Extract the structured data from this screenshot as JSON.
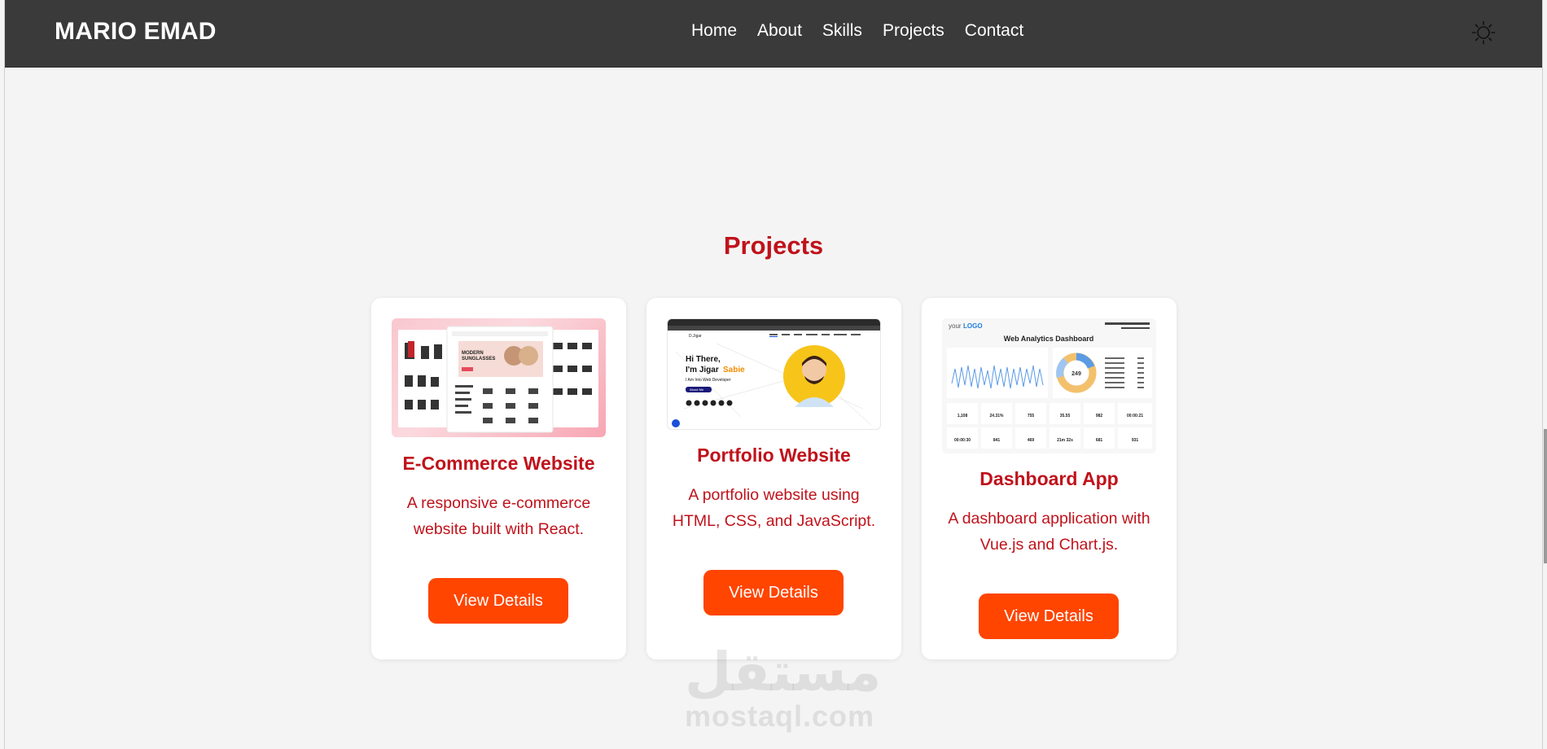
{
  "header": {
    "brand": "MARIO EMAD",
    "nav": [
      "Home",
      "About",
      "Skills",
      "Projects",
      "Contact"
    ],
    "theme_icon": "sun-icon"
  },
  "projects": {
    "title": "Projects",
    "cards": [
      {
        "title": "E-Commerce Website",
        "description": "A responsive e-commerce website built with React.",
        "button": "View Details",
        "thumb_texts": [
          "MODERN",
          "SUNGLASSES"
        ]
      },
      {
        "title": "Portfolio Website",
        "description": "A portfolio website using HTML, CSS, and JavaScript.",
        "button": "View Details",
        "thumb_texts": [
          "Hi There,",
          "I'm Jigar",
          "Sabie",
          "I Am Into Web Developer",
          "About Me",
          "D.Jigar"
        ]
      },
      {
        "title": "Dashboard App",
        "description": "A dashboard application with Vue.js and Chart.js.",
        "button": "View Details",
        "thumb_texts": [
          "your",
          "LOGO",
          "Web Analytics Dashboard",
          "249",
          "1,108",
          "24.31%",
          "755",
          "35.55",
          "982",
          "00:00:21",
          "00:00:30",
          "841",
          "469",
          "21m 32s",
          "681",
          "931"
        ]
      }
    ]
  },
  "watermark": {
    "arabic": "مستقل",
    "latin": "mostaql.com"
  },
  "colors": {
    "accent": "#c0121b",
    "button": "#ff4500",
    "navbar": "#3a3a3a",
    "background": "#f4f4f4"
  }
}
